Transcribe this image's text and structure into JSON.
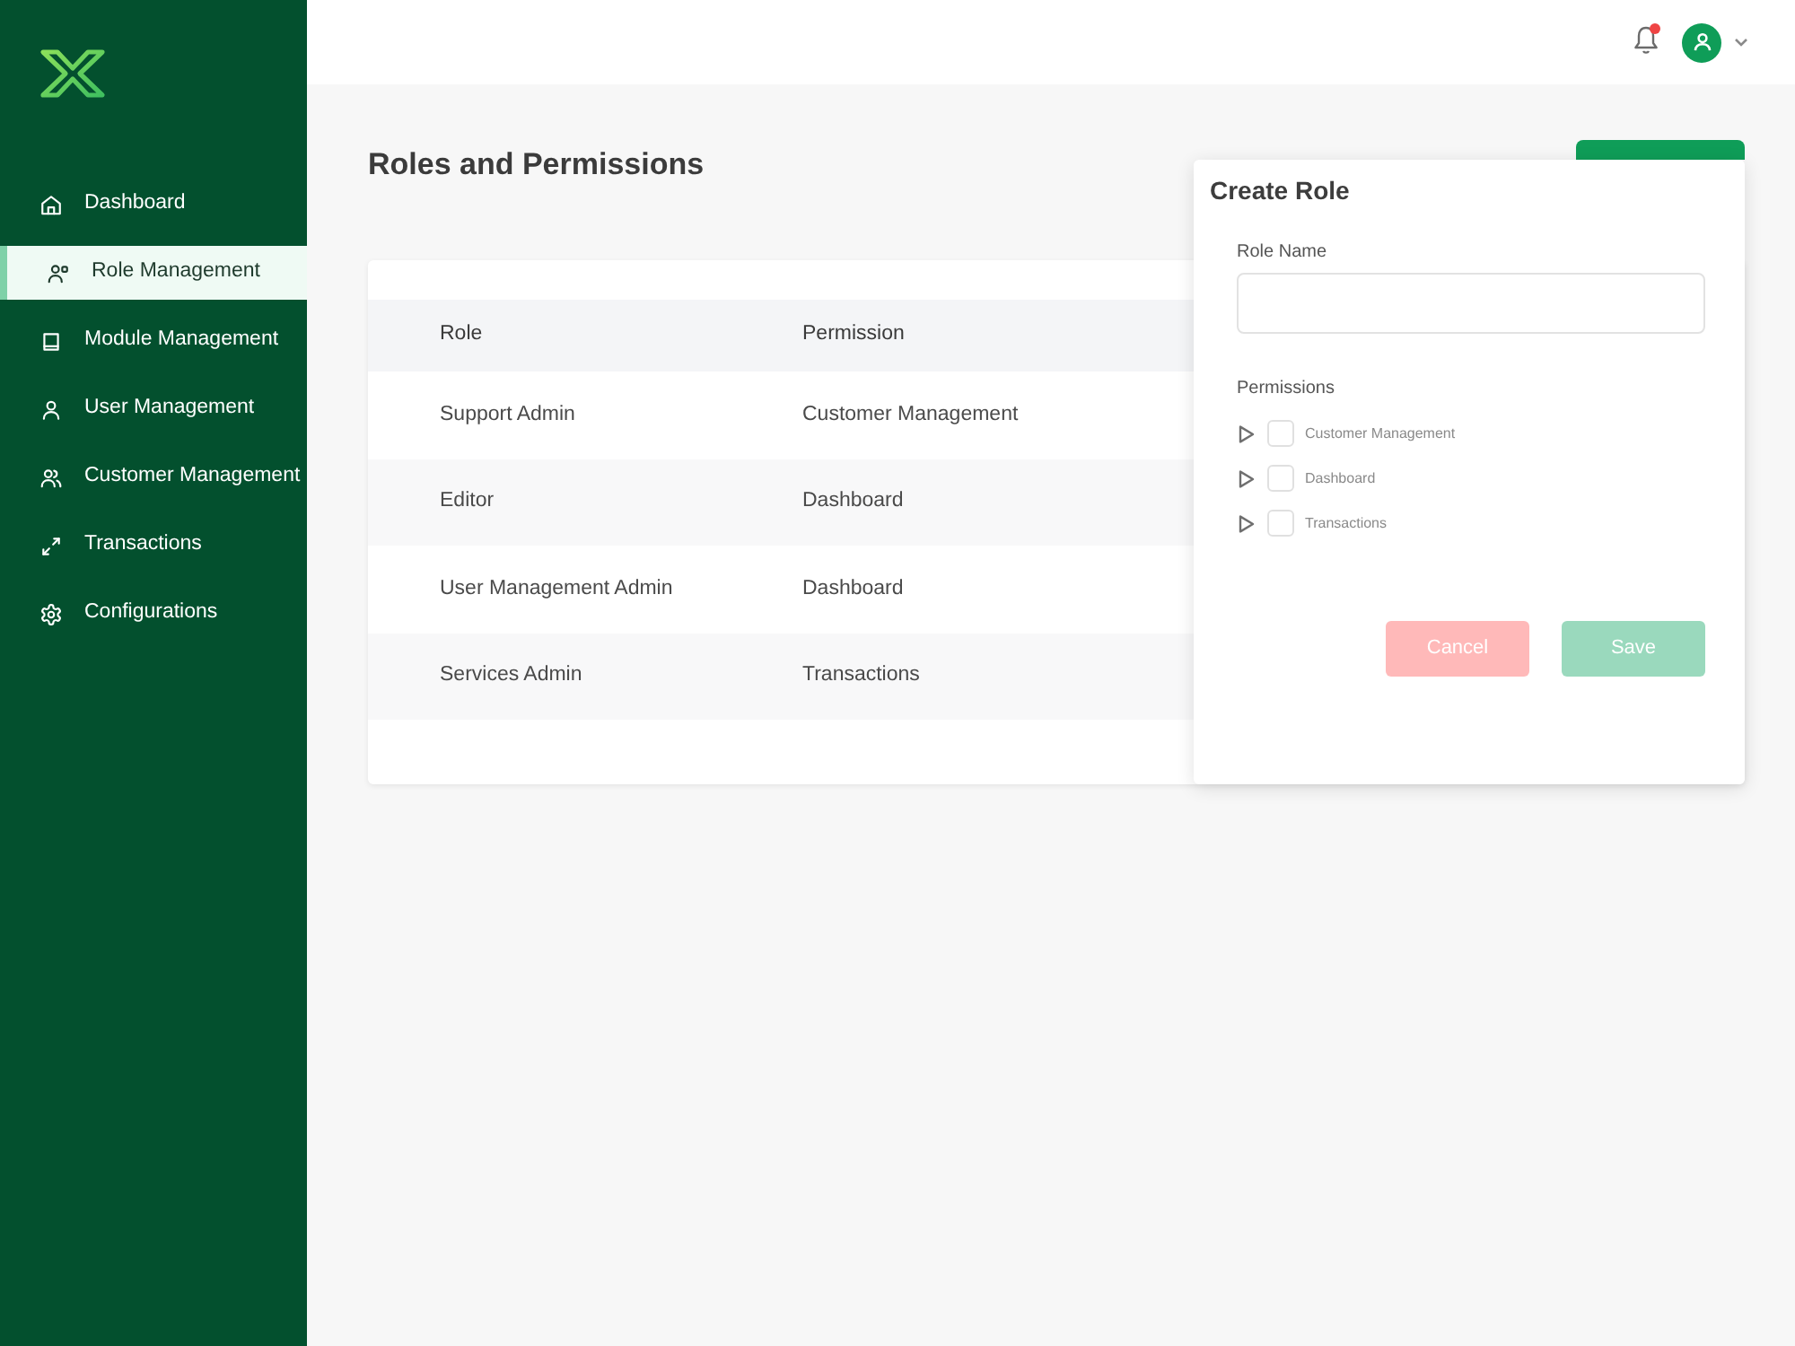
{
  "sidebar": {
    "items": [
      {
        "label": "Dashboard",
        "selected": false
      },
      {
        "label": "Role Management",
        "selected": true
      },
      {
        "label": "Module Management",
        "selected": false
      },
      {
        "label": "User Management",
        "selected": false
      },
      {
        "label": "Customer Management",
        "selected": false
      },
      {
        "label": "Transactions",
        "selected": false
      },
      {
        "label": "Configurations",
        "selected": false
      }
    ]
  },
  "header": {
    "has_notification": true
  },
  "page": {
    "title": "Roles and Permissions"
  },
  "table": {
    "columns": [
      "Role",
      "Permission"
    ],
    "rows": [
      [
        "Support Admin",
        "Customer Management"
      ],
      [
        "Editor",
        "Dashboard"
      ],
      [
        "User Management Admin",
        "Dashboard"
      ],
      [
        "Services Admin",
        "Transactions"
      ]
    ]
  },
  "create_role_panel": {
    "title": "Create Role",
    "role_name": {
      "label": "Role Name"
    },
    "permissions": {
      "label": "Permissions",
      "items": [
        {
          "label": "Customer Management",
          "expanded": false,
          "checked": false
        },
        {
          "label": "Dashboard",
          "expanded": false,
          "checked": false
        },
        {
          "label": "Transactions",
          "expanded": false,
          "checked": false
        }
      ]
    },
    "buttons": [
      {
        "label": "Cancel",
        "kind": "cancel",
        "disabled": true
      },
      {
        "label": "Save",
        "kind": "save",
        "disabled": true
      }
    ]
  }
}
